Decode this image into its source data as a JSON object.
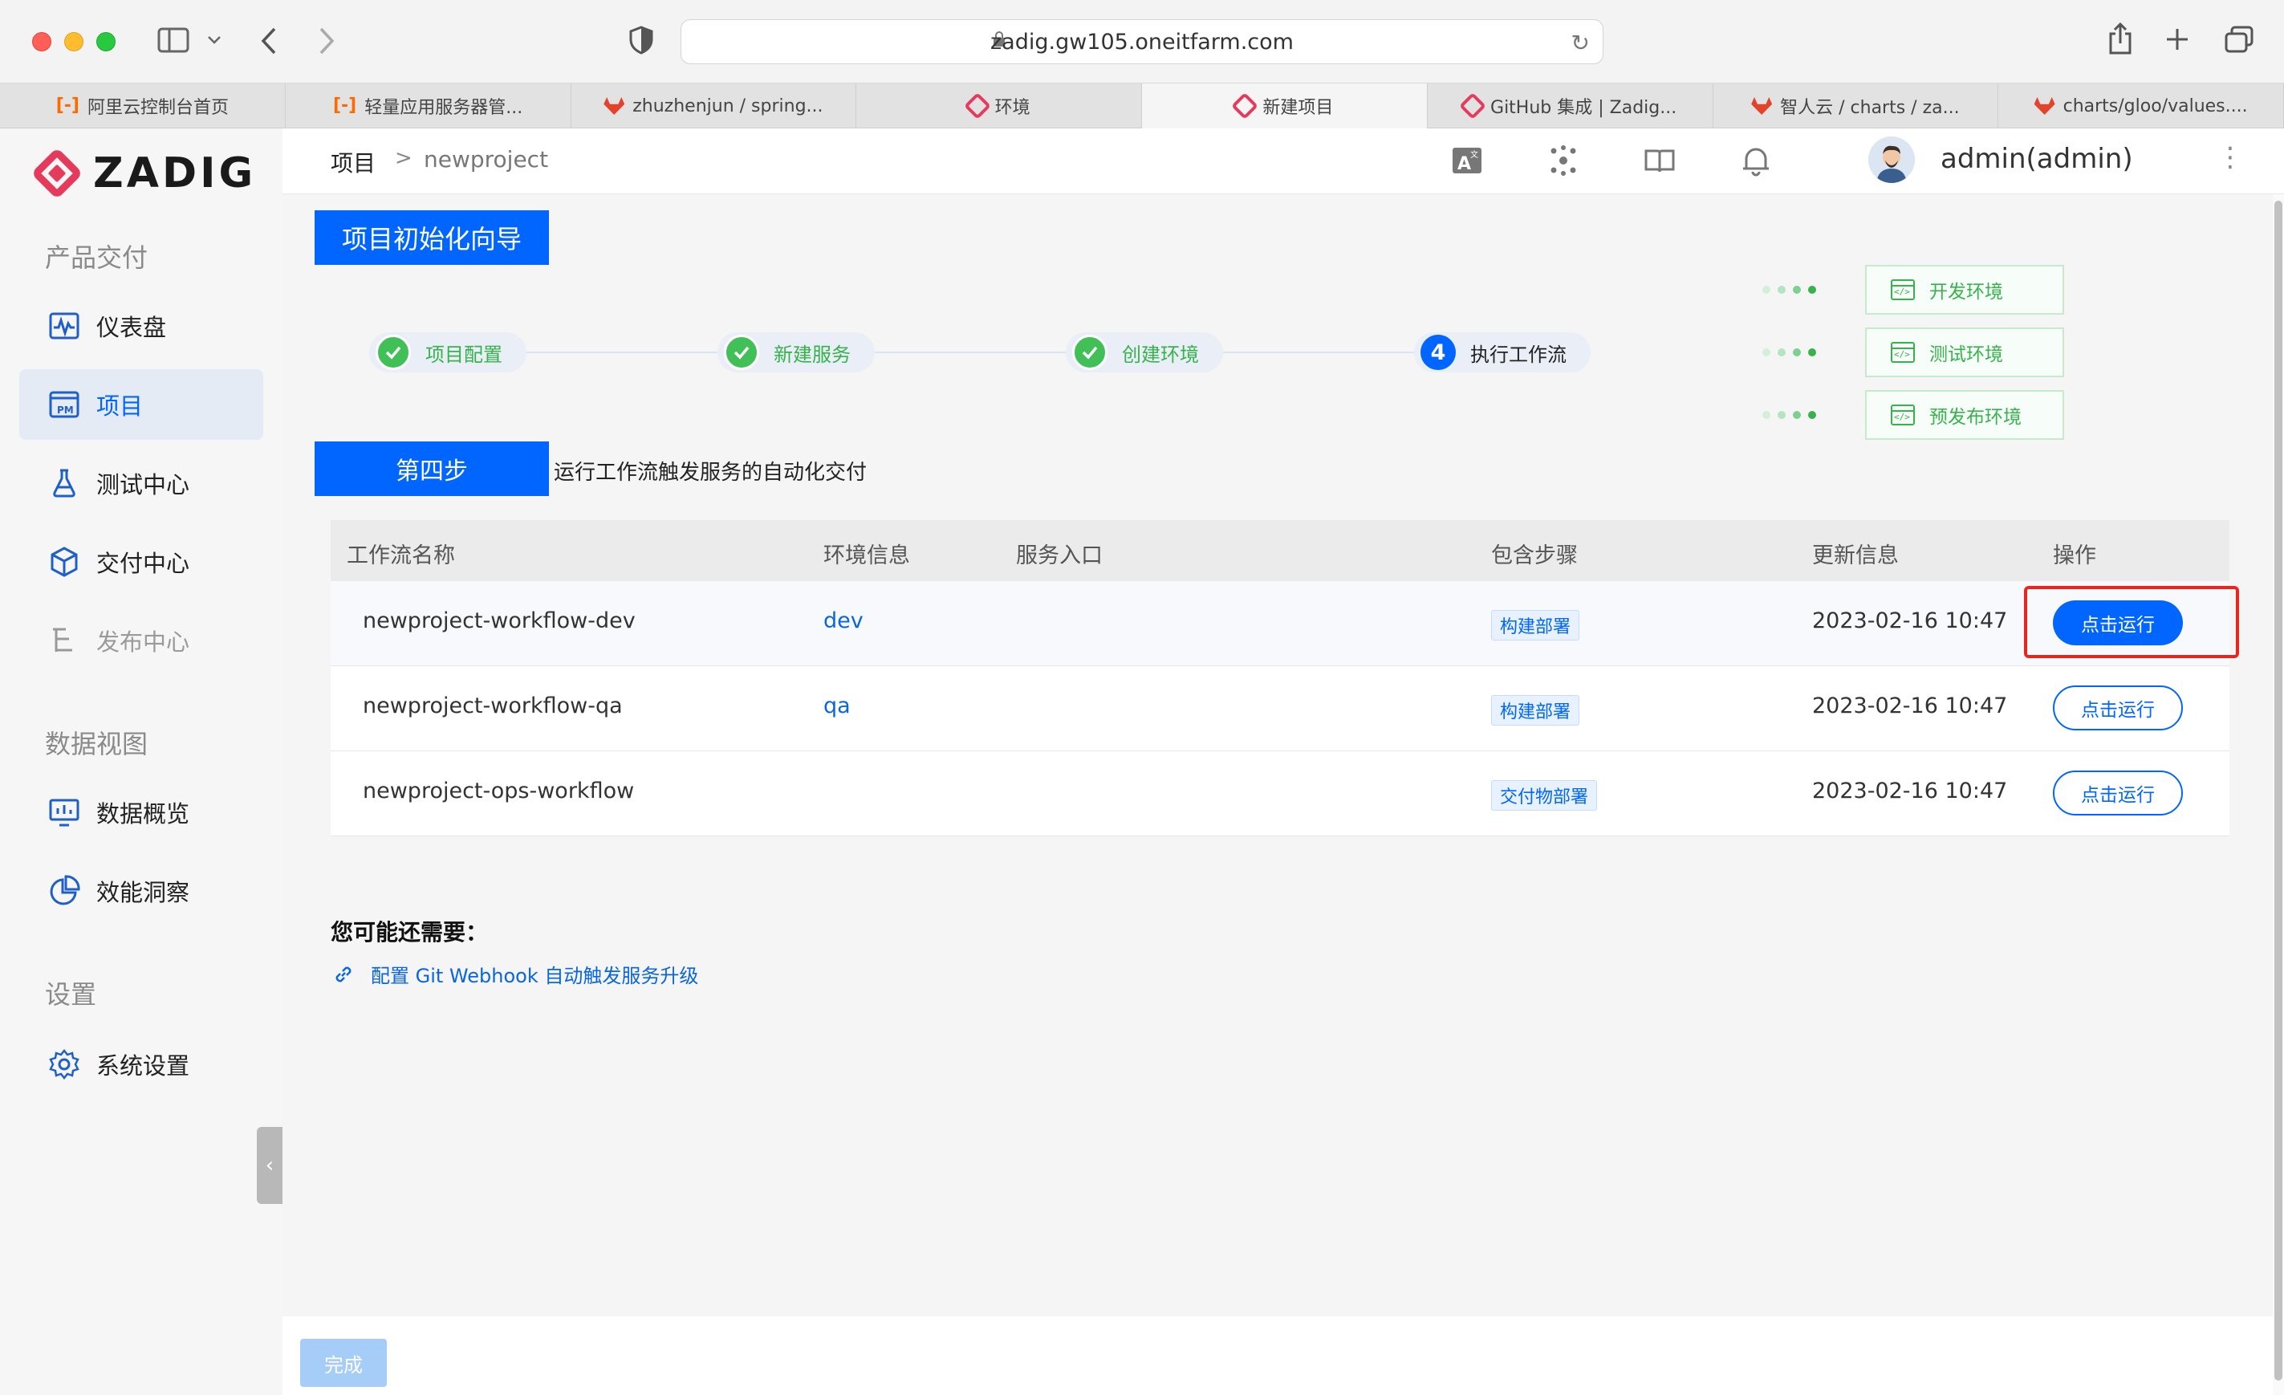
{
  "browser": {
    "url": "zadig.gw105.oneitfarm.com",
    "tabs": [
      {
        "label": "阿里云控制台首页",
        "icon": "aliyun-icon"
      },
      {
        "label": "轻量应用服务器管...",
        "icon": "aliyun-icon"
      },
      {
        "label": "zhuzhenjun / spring...",
        "icon": "gitlab-icon"
      },
      {
        "label": "环境",
        "icon": "zadig-icon"
      },
      {
        "label": "新建项目",
        "icon": "zadig-icon",
        "active": true
      },
      {
        "label": "GitHub 集成 | Zadig...",
        "icon": "zadig-icon"
      },
      {
        "label": "智人云 / charts / za...",
        "icon": "gitlab-icon"
      },
      {
        "label": "charts/gloo/values....",
        "icon": "gitlab-icon"
      }
    ]
  },
  "sidebar": {
    "logo": "ZADIG",
    "sections": [
      "产品交付",
      "数据视图",
      "设置"
    ],
    "items": [
      {
        "label": "仪表盘",
        "icon": "dashboard-icon"
      },
      {
        "label": "项目",
        "icon": "project-icon",
        "active": true
      },
      {
        "label": "测试中心",
        "icon": "flask-icon"
      },
      {
        "label": "交付中心",
        "icon": "package-icon"
      },
      {
        "label": "发布中心",
        "icon": "release-tree-icon",
        "disabled": true
      },
      {
        "label": "数据概览",
        "icon": "chart-monitor-icon"
      },
      {
        "label": "效能洞察",
        "icon": "pie-chart-icon"
      },
      {
        "label": "系统设置",
        "icon": "gear-icon"
      }
    ]
  },
  "header": {
    "breadcrumb": [
      "项目",
      ">",
      "newproject"
    ],
    "user": "admin(admin)"
  },
  "wizard": {
    "title": "项目初始化向导",
    "steps": [
      {
        "label": "项目配置",
        "status": "done"
      },
      {
        "label": "新建服务",
        "status": "done"
      },
      {
        "label": "创建环境",
        "status": "done"
      },
      {
        "number": "4",
        "label": "执行工作流",
        "status": "current"
      }
    ],
    "environments": [
      "开发环境",
      "测试环境",
      "预发布环境"
    ],
    "step_tag": "第四步",
    "step_desc": "运行工作流触发服务的自动化交付"
  },
  "table": {
    "columns": [
      "工作流名称",
      "环境信息",
      "服务入口",
      "包含步骤",
      "更新信息",
      "操作"
    ],
    "rows": [
      {
        "name": "newproject-workflow-dev",
        "env": "dev",
        "entry": "",
        "steps": "构建部署",
        "updated": "2023-02-16 10:47",
        "action": "点击运行"
      },
      {
        "name": "newproject-workflow-qa",
        "env": "qa",
        "entry": "",
        "steps": "构建部署",
        "updated": "2023-02-16 10:47",
        "action": "点击运行"
      },
      {
        "name": "newproject-ops-workflow",
        "env": "",
        "entry": "",
        "steps": "交付物部署",
        "updated": "2023-02-16 10:47",
        "action": "点击运行"
      }
    ]
  },
  "more": {
    "title": "您可能还需要：",
    "link": "配置 Git Webhook 自动触发服务升级"
  },
  "footer": {
    "done": "完成"
  },
  "colors": {
    "primary": "#0066ff",
    "success": "#37b24d",
    "highlight": "#e8261d",
    "brand": "#e63a5c"
  }
}
